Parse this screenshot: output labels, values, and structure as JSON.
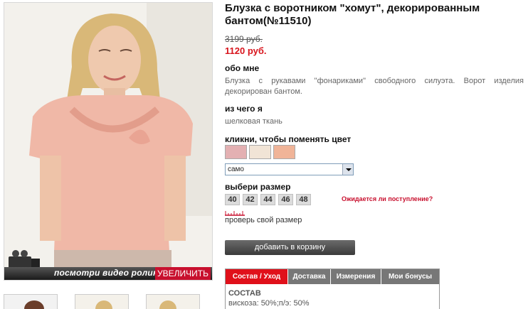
{
  "product": {
    "title": "Блузка с воротником \"хомут\", декорированным бантом(№11510)",
    "old_price": "3199 руб.",
    "new_price": "1120 руб."
  },
  "about": {
    "heading": "обо мне",
    "text": "Блузка с рукавами \"фонариками\" свободного силуэта. Ворот изделия декорирован бантом."
  },
  "material": {
    "heading": "из чего я",
    "text": "шелковая ткань"
  },
  "colors": {
    "heading": "кликни, чтобы поменять цвет",
    "swatches": [
      "#e3b0b2",
      "#f1e4d6",
      "#f0b498"
    ],
    "selected": "само"
  },
  "sizes": {
    "heading": "выбери размер",
    "items": [
      "40",
      "42",
      "44",
      "46",
      "48"
    ],
    "awaiting_link": "Ожидается ли поступление?",
    "check_size_link": "проверь свой размер"
  },
  "cart_button": "добавить в корзину",
  "media": {
    "video_link": "посмотри видео ролик",
    "zoom_link": "УВЕЛИЧИТЬ"
  },
  "tabs": {
    "items": [
      "Состав / Уход",
      "Доставка",
      "Измерения",
      "Мои бонусы"
    ],
    "active_heading": "СОСТАВ",
    "active_text": "вискоза: 50%;п/э: 50%"
  },
  "colors_theme": {
    "accent": "#d8141c",
    "button": "#4a4a4a"
  }
}
